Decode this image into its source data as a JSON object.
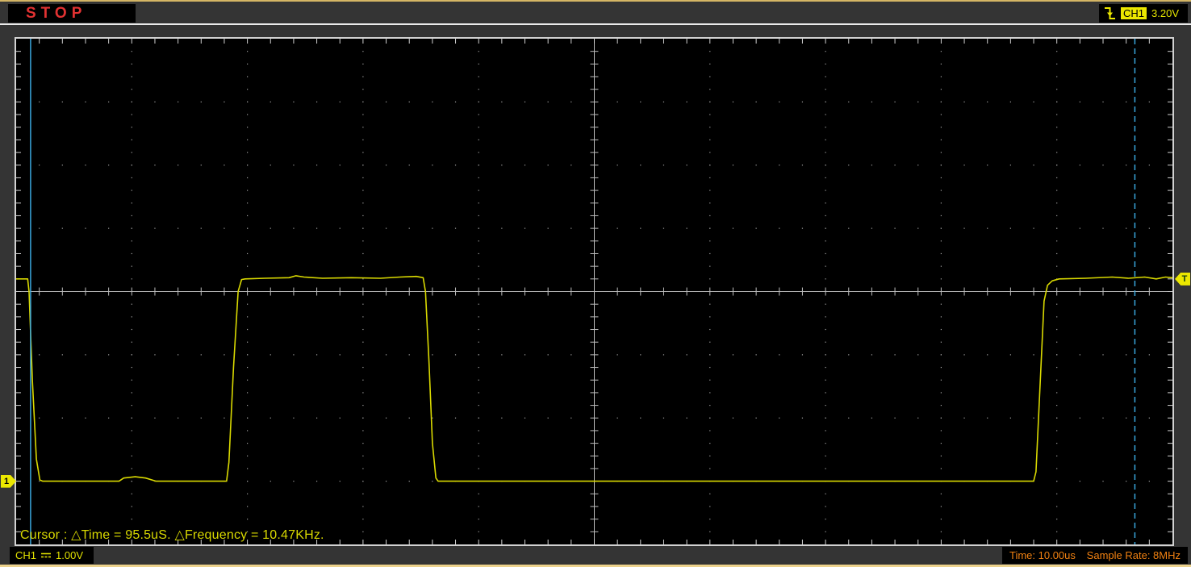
{
  "header": {
    "status_label": "STOP",
    "trigger": {
      "icon": "falling-edge-trigger-icon",
      "channel": "CH1",
      "level": "3.20V"
    }
  },
  "plot": {
    "cursor_readout": "Cursor : △Time = 95.5uS. △Frequency = 10.47KHz.",
    "ground_marker_label": "1",
    "trigger_marker_label": "T"
  },
  "footer": {
    "channel_name": "CH1",
    "coupling_icon": "dc-coupling-icon",
    "volts_per_div_label": "1.00V",
    "timebase_label": "Time: 10.00us",
    "sample_rate_label": "Sample Rate: 8MHz"
  },
  "chart_data": {
    "type": "line",
    "title": "Oscilloscope CH1 square-wave trace",
    "x_unit": "us",
    "y_unit": "V",
    "x_divisions": 10,
    "y_divisions": 8,
    "time_per_div_us": 10.0,
    "volts_per_div": 1.0,
    "ground_div_from_bottom": 1.0,
    "trigger_level_v": 3.2,
    "high_level_v": 3.2,
    "low_level_v": 0.0,
    "cursor1_time_us": 1.25,
    "cursor2_time_us": 96.75,
    "delta_time_us": 95.5,
    "delta_frequency_khz": 10.47,
    "sample_rate_mhz": 8,
    "series": [
      {
        "name": "CH1",
        "points": [
          [
            0.0,
            3.2
          ],
          [
            1.0,
            3.2
          ],
          [
            1.12,
            3.0
          ],
          [
            1.4,
            1.6
          ],
          [
            1.75,
            0.35
          ],
          [
            2.05,
            0.02
          ],
          [
            2.3,
            0.0
          ],
          [
            8.9,
            0.0
          ],
          [
            9.3,
            0.05
          ],
          [
            10.3,
            0.07
          ],
          [
            11.2,
            0.05
          ],
          [
            12.1,
            0.0
          ],
          [
            18.2,
            0.0
          ],
          [
            18.4,
            0.3
          ],
          [
            18.8,
            1.8
          ],
          [
            19.2,
            3.0
          ],
          [
            19.5,
            3.19
          ],
          [
            19.8,
            3.2
          ],
          [
            21.5,
            3.21
          ],
          [
            23.6,
            3.22
          ],
          [
            24.2,
            3.25
          ],
          [
            24.9,
            3.23
          ],
          [
            26.5,
            3.21
          ],
          [
            29.0,
            3.22
          ],
          [
            31.5,
            3.21
          ],
          [
            33.2,
            3.23
          ],
          [
            34.6,
            3.24
          ],
          [
            35.2,
            3.22
          ],
          [
            35.4,
            3.0
          ],
          [
            35.7,
            1.9
          ],
          [
            36.0,
            0.6
          ],
          [
            36.3,
            0.05
          ],
          [
            36.5,
            0.0
          ],
          [
            55.0,
            0.0
          ],
          [
            88.0,
            0.0
          ],
          [
            88.2,
            0.15
          ],
          [
            88.55,
            1.5
          ],
          [
            88.9,
            2.85
          ],
          [
            89.2,
            3.1
          ],
          [
            89.6,
            3.17
          ],
          [
            90.2,
            3.2
          ],
          [
            92.5,
            3.21
          ],
          [
            94.8,
            3.23
          ],
          [
            96.2,
            3.21
          ],
          [
            97.6,
            3.23
          ],
          [
            98.6,
            3.2
          ],
          [
            99.4,
            3.23
          ],
          [
            100.0,
            3.22
          ]
        ]
      }
    ],
    "colors": {
      "trace": "#d9d900",
      "cursor": "#3aa6dc",
      "graticule_dot": "#a0a0a0",
      "graticule_line": "#bcbcbc",
      "border_tick": "#d0d0d0",
      "marker_yellow": "#ece800",
      "status_red": "#e23232",
      "readout_yellow": "#d8d800",
      "info_orange": "#ef8011",
      "chrome_gray": "#343434",
      "chrome_tan": "#d4b564"
    }
  }
}
